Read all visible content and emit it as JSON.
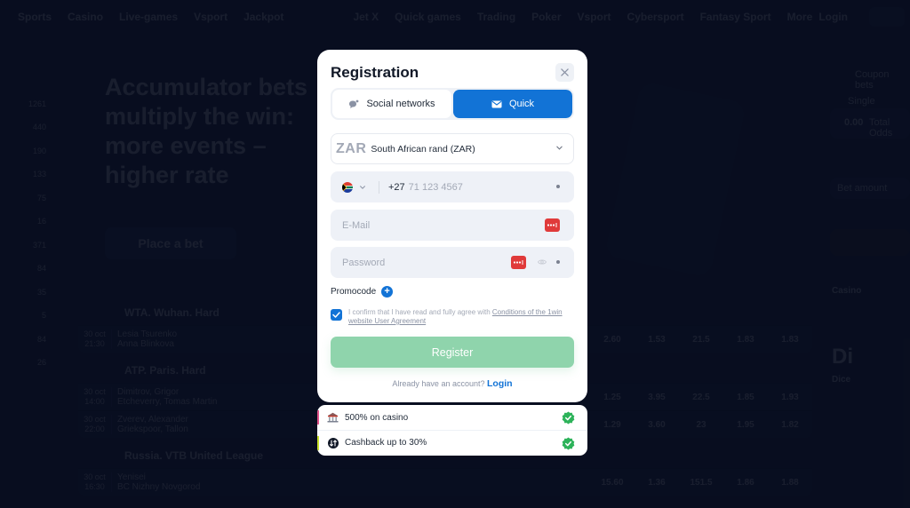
{
  "background": {
    "nav": [
      "Sports",
      "Casino",
      "Live-games",
      "Vsport",
      "Jackpot",
      "Jet X",
      "Quick games",
      "Trading",
      "Poker",
      "Vsport",
      "Cybersport",
      "Fantasy Sport",
      "More"
    ],
    "nav_login": "Login",
    "rail_counts": [
      "1261",
      "440",
      "190",
      "133",
      "75",
      "16",
      "371",
      "84",
      "35",
      "5",
      "84",
      "26"
    ],
    "hero_title": "Accumulator bets multiply the win: more events – higher rate",
    "hero_button": "Place a bet",
    "right_panel": {
      "coupon": "Coupon bets",
      "single": "Single",
      "total_odds_value": "0.00",
      "total_odds_label": "Total Odds",
      "amount_placeholder": "Bet amount",
      "casino_heading": "Casino",
      "game_abbr": "Di",
      "game_name": "Dice"
    },
    "leagues": [
      {
        "name": "WTA. Wuhan. Hard",
        "matches": [
          {
            "date": "30 oct",
            "time": "21:30",
            "team1": "Lesia Tsurenko",
            "team2": "Anna Blinkova",
            "odds": [
              "2.60",
              "1.53",
              "21.5",
              "1.83",
              "1.83"
            ]
          }
        ]
      },
      {
        "name": "ATP. Paris. Hard",
        "matches": [
          {
            "date": "30 oct",
            "time": "14:00",
            "team1": "Dimitrov, Grigor",
            "team2": "Etcheverry, Tomas Martin",
            "odds": [
              "1.25",
              "3.95",
              "22.5",
              "1.85",
              "1.93"
            ]
          },
          {
            "date": "30 oct",
            "time": "22:00",
            "team1": "Zverev, Alexander",
            "team2": "Griekspoor, Tallon",
            "odds": [
              "1.29",
              "3.60",
              "23",
              "1.95",
              "1.82"
            ]
          }
        ]
      },
      {
        "name": "Russia. VTB United League",
        "matches": [
          {
            "date": "30 oct",
            "time": "16:30",
            "team1": "Yenisei",
            "team2": "BC Nizhny Novgorod",
            "odds": [
              "15.60",
              "1.36",
              "151.5",
              "1.86",
              "1.88"
            ]
          }
        ]
      }
    ]
  },
  "modal": {
    "title": "Registration",
    "close_icon": "close-icon",
    "tabs": [
      {
        "label": "Social networks",
        "icon": "chat-bubble-icon",
        "active": false
      },
      {
        "label": "Quick",
        "icon": "envelope-icon",
        "active": true
      }
    ],
    "currency": {
      "code": "ZAR",
      "name": "South African rand (ZAR)"
    },
    "phone": {
      "country_flag": "south-africa-flag",
      "prefix": "+27",
      "placeholder": "71 123 4567",
      "value": ""
    },
    "email": {
      "placeholder": "E-Mail",
      "value": ""
    },
    "password": {
      "placeholder": "Password",
      "value": ""
    },
    "promocode_label": "Promocode",
    "agreement": {
      "checked": true,
      "text": "I confirm that I have read and fully agree with ",
      "link": "Conditions of the 1win website User Agreement"
    },
    "register_button": "Register",
    "have_account": "Already have an account?",
    "login_link": "Login"
  },
  "bonuses": [
    {
      "label": "500% on casino",
      "icon": "casino-building-icon",
      "stripe_color": "#e0528a"
    },
    {
      "label": "Cashback up to 30%",
      "icon": "cashback-icon",
      "stripe_color": "#c8e02a"
    }
  ],
  "colors": {
    "accent": "#1273d6",
    "register_button": "#8fd4ac",
    "check_green": "#2db35a",
    "password_manager": "#e03a3a"
  }
}
